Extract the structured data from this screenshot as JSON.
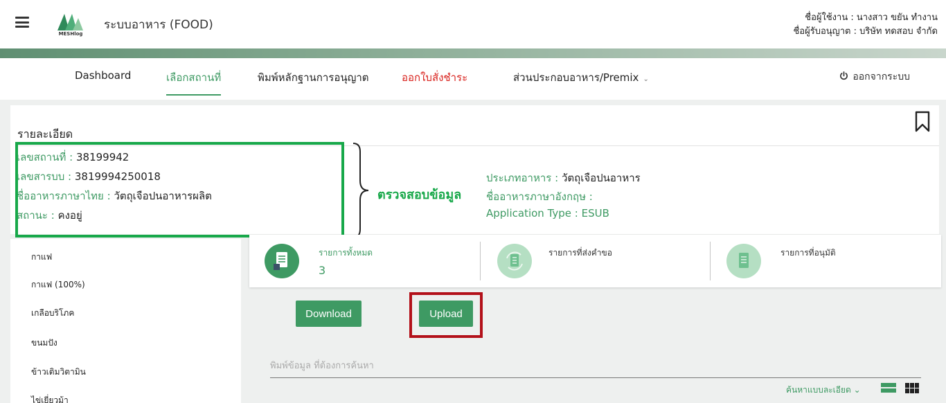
{
  "header": {
    "app_title": "ระบบอาหาร (FOOD)",
    "logo_text": "MESHlog",
    "user_line": "ชื่อผู้ใช้งาน : นางสาว ขยัน ทำงาน",
    "licensee_line": "ชื่อผู้รับอนุญาต : บริษัท ทดสอบ จำกัด",
    "accent_color": "#3e9a63"
  },
  "nav": {
    "dashboard": "Dashboard",
    "select_location": "เลือกสถานที่",
    "print_license": "พิมพ์หลักฐานการอนุญาต",
    "issue_payment": "ออกใบสั่งชำระ",
    "ingredients": "ส่วนประกอบอาหาร/Premix",
    "logout": "ออกจากระบบ"
  },
  "details": {
    "title": "รายละเอียด",
    "location_no_label": "เลขสถานที่ :",
    "location_no": "38199942",
    "serial_no_label": "เลขสารบบ :",
    "serial_no": "3819994250018",
    "thai_name_label": "ชื่ออาหารภาษาไทย :",
    "thai_name": "วัตถุเจือปนอาหารผลิต",
    "status_label": "สถานะ :",
    "status": "คงอยู่",
    "food_type_label": "ประเภทอาหาร :",
    "food_type": "วัตถุเจือปนอาหาร",
    "english_name_label": "ชื่ออาหารภาษาอังกฤษ :",
    "english_name": "",
    "application_type_label": "Application Type :",
    "application_type": "ESUB"
  },
  "annotation": {
    "check_label": "ตรวจสอบข้อมูล",
    "box_color": "#18a84a",
    "upload_frame_color": "#b3111a"
  },
  "sidebar": {
    "items": [
      "กาแฟ",
      "กาแฟ (100%)",
      "เกลือบริโภค",
      "ขนมปัง",
      "ข้าวเติมวิตามิน",
      "ไข่เยี่ยวม้า"
    ]
  },
  "stats": {
    "total_label": "รายการทั้งหมด",
    "total_value": "3",
    "submitted_label": "รายการที่ส่งคำขอ",
    "approved_label": "รายการที่อนุมัติ"
  },
  "actions": {
    "download": "Download",
    "upload": "Upload"
  },
  "search": {
    "placeholder": "พิมพ์ข้อมูล ที่ต้องการค้นหา",
    "advanced": "ค้นหาแบบละเอียด"
  },
  "icons": {
    "menu": "hamburger-menu-icon",
    "bookmark": "bookmark-icon",
    "power": "power-icon",
    "document": "document-icon",
    "refresh_document": "refresh-document-icon",
    "list_view": "list-view-icon",
    "grid_view": "grid-view-icon"
  }
}
